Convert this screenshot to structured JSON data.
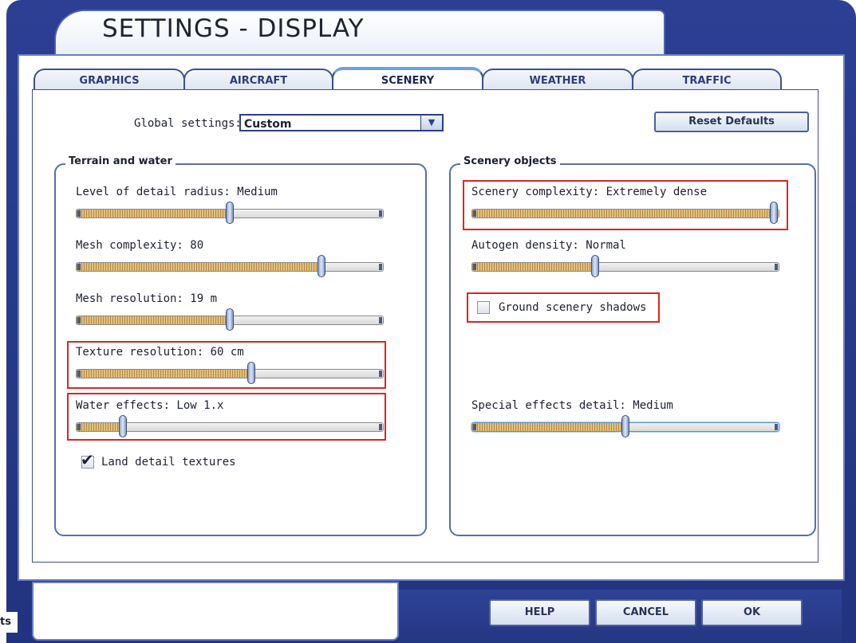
{
  "window": {
    "title": "SETTINGS - DISPLAY"
  },
  "tabs": [
    {
      "label": "GRAPHICS",
      "active": false
    },
    {
      "label": "AIRCRAFT",
      "active": false
    },
    {
      "label": "SCENERY",
      "active": true
    },
    {
      "label": "WEATHER",
      "active": false
    },
    {
      "label": "TRAFFIC",
      "active": false
    }
  ],
  "global": {
    "label": "Global settings:",
    "value": "Custom",
    "reset_label": "Reset Defaults"
  },
  "terrain": {
    "title": "Terrain and water",
    "lod": {
      "label": "Level of detail radius: Medium",
      "level": 0.5
    },
    "mesh_complexity": {
      "label": "Mesh complexity: 80",
      "level": 0.8
    },
    "mesh_resolution": {
      "label": "Mesh resolution: 19 m",
      "level": 0.5
    },
    "texture_resolution": {
      "label": "Texture resolution: 60 cm",
      "level": 0.57
    },
    "water_effects": {
      "label": "Water effects: Low 1.x",
      "level": 0.15
    },
    "land_detail": {
      "label": "Land detail textures",
      "checked": true
    }
  },
  "scenery": {
    "title": "Scenery objects",
    "complexity": {
      "label": "Scenery complexity: Extremely dense",
      "level": 1.0
    },
    "autogen": {
      "label": "Autogen density: Normal",
      "level": 0.4
    },
    "ground_shadows": {
      "label": "Ground scenery shadows",
      "checked": false
    },
    "special_effects": {
      "label": "Special effects detail: Medium",
      "level": 0.5
    }
  },
  "footer": {
    "help_label": "HELP",
    "cancel_label": "CANCEL",
    "ok_label": "OK",
    "edge_text": "ts"
  },
  "colors": {
    "highlight": "#e0241f",
    "frame": "#2c3f93",
    "slider_fill": "#d4ad62"
  }
}
